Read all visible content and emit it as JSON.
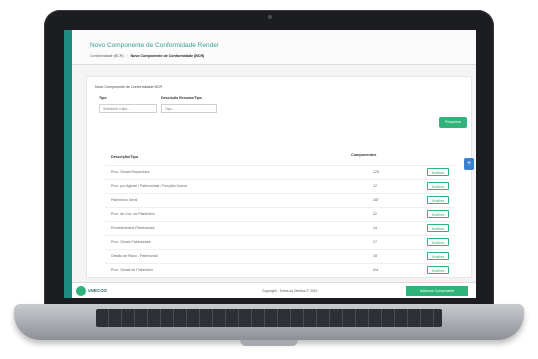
{
  "header": {
    "title": "Novo Componente de Conformidade Render",
    "breadcrumb": [
      "Conformidade (BCR)",
      "Novo Componente de Conformidade (BCR)"
    ]
  },
  "form": {
    "section_heading": "Novo Componente de Conformidade BCR",
    "tipo_label": "Tipo",
    "tipo_value": "Selecione o tipo...",
    "descricao_label": "Descrição Resumo/Tipo",
    "descricao_value": "Tipo...",
    "search_button": "Pesquisar"
  },
  "table": {
    "header_desc": "Descrição/Tipo",
    "header_count": "Componentes",
    "rows": [
      {
        "desc": "Proc. Gerais Requeridos",
        "count": "123",
        "action": "Detalhes"
      },
      {
        "desc": "Proc. por Agente / Patrimoniais / Funções Outros",
        "count": "12",
        "action": "Detalhes"
      },
      {
        "desc": "Patrimônio Geral",
        "count": "187",
        "action": "Detalhes"
      },
      {
        "desc": "Proc. de Con. de Patrimônio",
        "count": "22",
        "action": "Detalhes"
      },
      {
        "desc": "Procedimentos Patrimoniais",
        "count": "14",
        "action": "Detalhes"
      },
      {
        "desc": "Proc. Gerais Patrimoniais",
        "count": "17",
        "action": "Detalhes"
      },
      {
        "desc": "Gestão de Risco - Patrimonial",
        "count": "15",
        "action": "Detalhes"
      },
      {
        "desc": "Proc. Gerais de Patrimônio",
        "count": "411",
        "action": "Detalhes"
      }
    ]
  },
  "add_button": "+",
  "footer": {
    "brand": "vNECOS",
    "copyright": "Copyright - Todos os Direitos © 2019",
    "button": "Adicionar Componente"
  },
  "colors": {
    "accent": "#2fb37a",
    "side_strip": "#1f8c83",
    "add_button": "#3d7fd1"
  }
}
